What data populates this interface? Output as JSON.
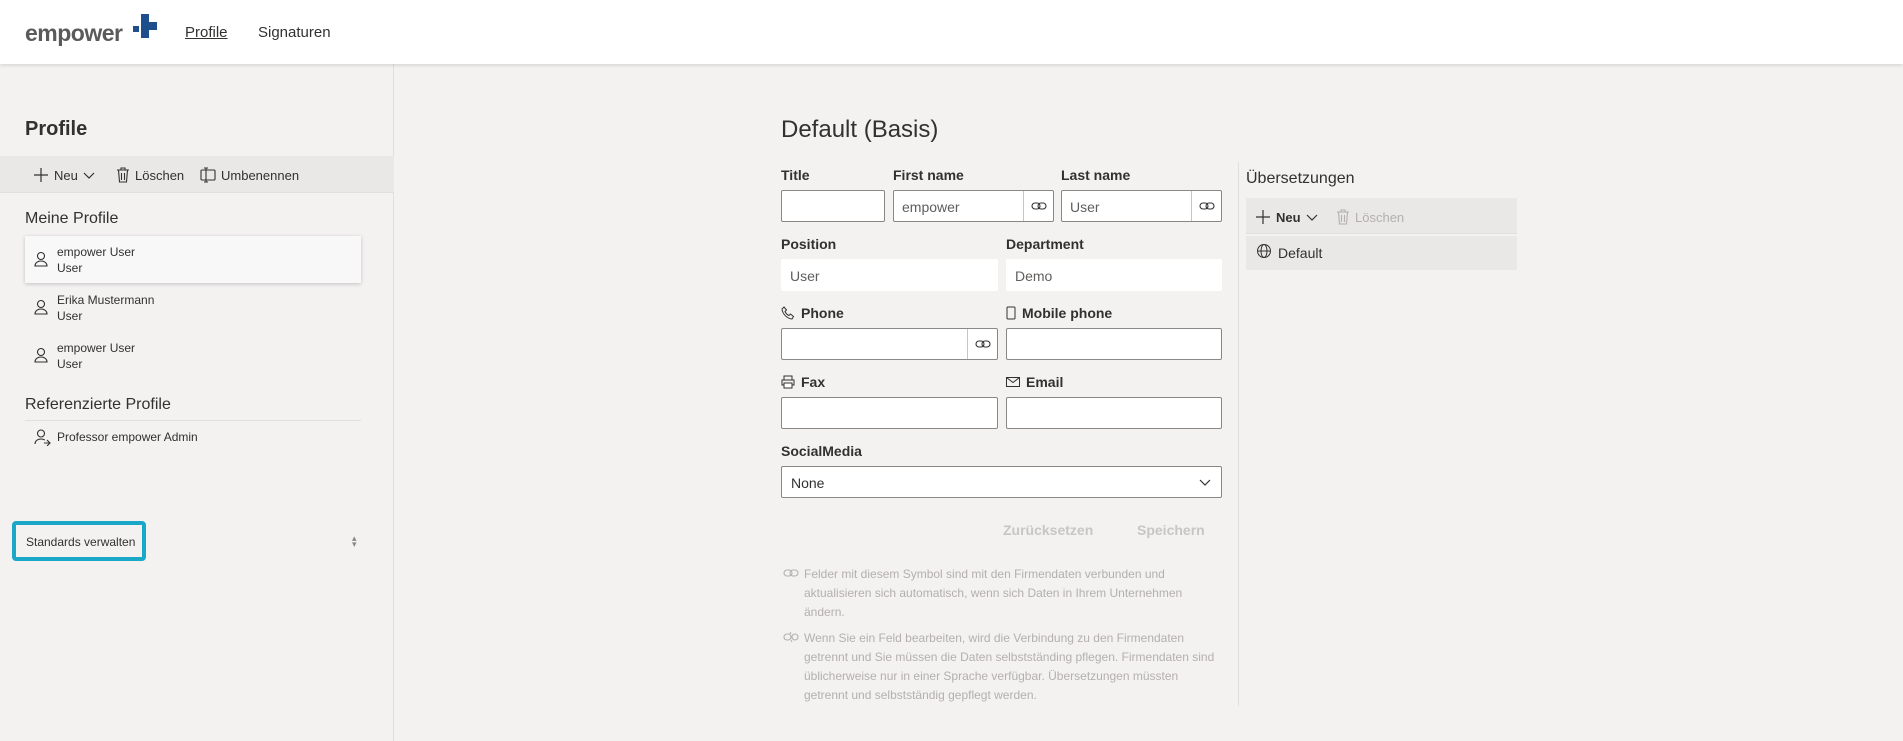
{
  "header": {
    "brand": "empower",
    "nav": [
      {
        "label": "Profile",
        "active": true
      },
      {
        "label": "Signaturen",
        "active": false
      }
    ]
  },
  "sidebar": {
    "title": "Profile",
    "commands": {
      "new": "Neu",
      "delete": "Löschen",
      "rename": "Umbenennen"
    },
    "my_profiles_heading": "Meine Profile",
    "my_profiles": [
      {
        "name": "empower User",
        "sub": "User",
        "selected": true
      },
      {
        "name": "Erika Mustermann",
        "sub": "User",
        "selected": false
      },
      {
        "name": "empower User",
        "sub": "User",
        "selected": false
      }
    ],
    "referenced_heading": "Referenzierte Profile",
    "referenced": [
      {
        "name": "Professor empower Admin"
      }
    ],
    "standards_button": "Standards verwalten"
  },
  "form": {
    "title": "Default (Basis)",
    "fields": {
      "title": {
        "label": "Title",
        "value": ""
      },
      "first_name": {
        "label": "First name",
        "value": "empower"
      },
      "last_name": {
        "label": "Last name",
        "value": "User"
      },
      "position": {
        "label": "Position",
        "value": "User"
      },
      "department": {
        "label": "Department",
        "value": "Demo"
      },
      "phone": {
        "label": "Phone",
        "value": ""
      },
      "mobile": {
        "label": "Mobile phone",
        "value": ""
      },
      "fax": {
        "label": "Fax",
        "value": ""
      },
      "email": {
        "label": "Email",
        "value": ""
      },
      "social": {
        "label": "SocialMedia",
        "value": "None"
      }
    },
    "reset_label": "Zurücksetzen",
    "save_label": "Speichern",
    "note_linked": "Felder mit diesem Symbol sind mit den Firmendaten verbunden und aktualisieren sich automatisch, wenn sich Daten in Ihrem Unternehmen ändern.",
    "note_unlinked": "Wenn Sie ein Feld bearbeiten, wird die Verbindung zu den Firmendaten getrennt und Sie müssen die Daten selbstständing pflegen. Firmendaten sind üblicherweise nur in einer Sprache verfügbar. Übersetzungen müssten getrennt und selbstständig gepflegt werden."
  },
  "translations": {
    "title": "Übersetzungen",
    "new": "Neu",
    "delete": "Löschen",
    "items": [
      {
        "label": "Default"
      }
    ]
  },
  "colors": {
    "accent": "#1aa7c8",
    "brand_mark": "#1f4e8c"
  }
}
